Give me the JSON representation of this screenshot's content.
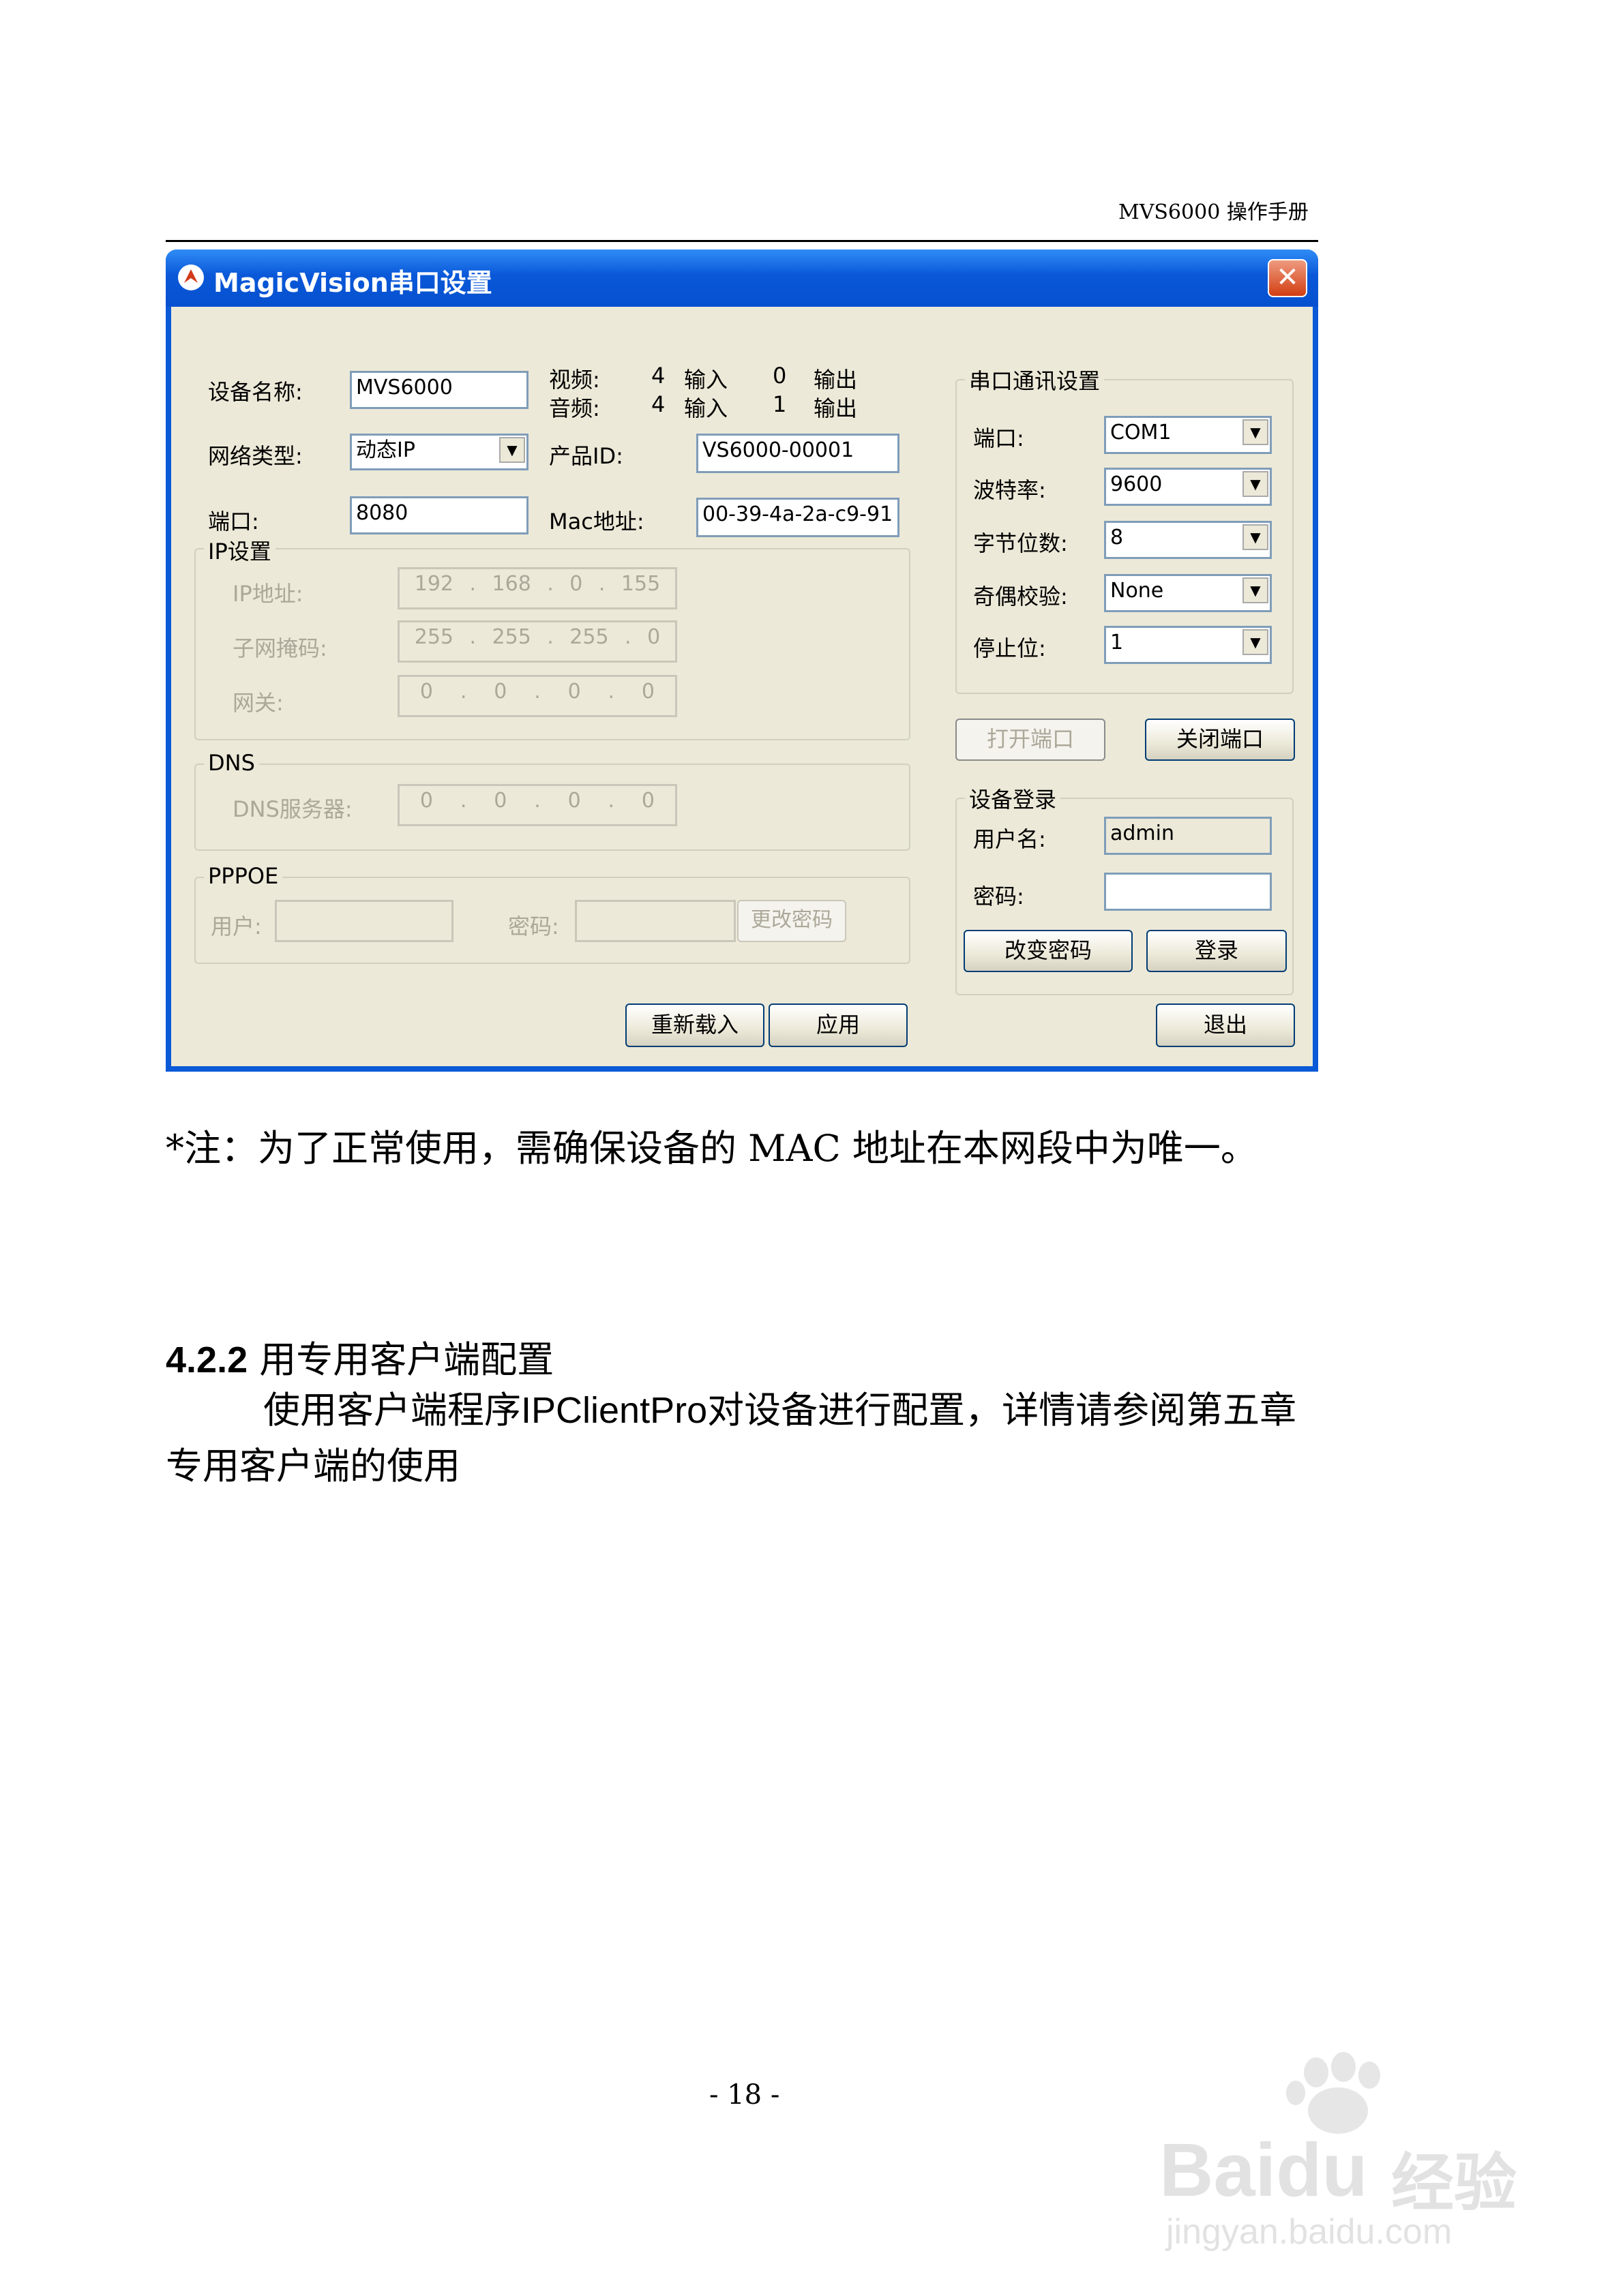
{
  "header": {
    "title": "MVS6000 操作手册"
  },
  "window": {
    "title": "MagicVision串口设置",
    "close_glyph": "✕",
    "device_name": {
      "label": "设备名称:",
      "value": "MVS6000"
    },
    "video": {
      "label": "视频:",
      "inputs": "4",
      "input_label": "输入",
      "outputs": "0",
      "output_label": "输出"
    },
    "audio": {
      "label": "音频:",
      "inputs": "4",
      "input_label": "输入",
      "outputs": "1",
      "output_label": "输出"
    },
    "network_type": {
      "label": "网络类型:",
      "value": "动态IP"
    },
    "product_id": {
      "label": "产品ID:",
      "value": "VS6000-00001"
    },
    "port": {
      "label": "端口:",
      "value": "8080"
    },
    "mac": {
      "label": "Mac地址:",
      "value": "00-39-4a-2a-c9-91"
    },
    "ip_group": {
      "title": "IP设置",
      "ip_label": "IP地址:",
      "ip": [
        "192",
        "168",
        "0",
        "155"
      ],
      "mask_label": "子网掩码:",
      "mask": [
        "255",
        "255",
        "255",
        "0"
      ],
      "gateway_label": "网关:",
      "gateway": [
        "0",
        "0",
        "0",
        "0"
      ]
    },
    "dns_group": {
      "title": "DNS",
      "server_label": "DNS服务器:",
      "server": [
        "0",
        "0",
        "0",
        "0"
      ]
    },
    "pppoe_group": {
      "title": "PPPOE",
      "user_label": "用户:",
      "password_label": "密码:",
      "change_button": "更改密码"
    },
    "serial_group": {
      "title": "串口通讯设置",
      "port_label": "端口:",
      "port_value": "COM1",
      "baud_label": "波特率:",
      "baud_value": "9600",
      "databits_label": "字节位数:",
      "databits_value": "8",
      "parity_label": "奇偶校验:",
      "parity_value": "None",
      "stopbits_label": "停止位:",
      "stopbits_value": "1"
    },
    "open_port_button": "打开端口",
    "close_port_button": "关闭端口",
    "login_group": {
      "title": "设备登录",
      "user_label": "用户名:",
      "user_value": "admin",
      "password_label": "密码:",
      "change_password_button": "改变密码",
      "login_button": "登录"
    },
    "reload_button": "重新载入",
    "apply_button": "应用",
    "exit_button": "退出"
  },
  "note": "*注：为了正常使用，需确保设备的 MAC 地址在本网段中为唯一。",
  "section": {
    "number": "4.2.2",
    "title": "用专用客户端配置"
  },
  "paragraph": {
    "part1": "使用客户端程序",
    "program": "IPClientPro",
    "part2": "对设备进行配置，详情请参阅第五章",
    "line2": "专用客户端的使用"
  },
  "page_number": "- 18 -",
  "watermark": {
    "brand": "Bai",
    "brand2": "du",
    "product": "经验",
    "url": "jingyan.baidu.com"
  }
}
